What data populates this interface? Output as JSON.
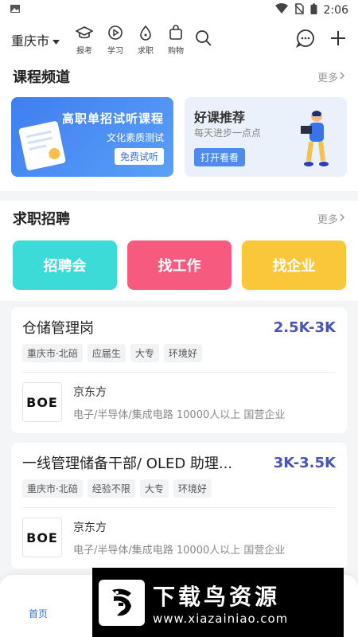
{
  "status": {
    "time": "2:06"
  },
  "topnav": {
    "city": "重庆市",
    "items": [
      {
        "label": "报考",
        "icon": "graduation-cap-icon"
      },
      {
        "label": "学习",
        "icon": "play-circle-icon"
      },
      {
        "label": "求职",
        "icon": "job-icon"
      },
      {
        "label": "购物",
        "icon": "shopping-bag-icon"
      }
    ]
  },
  "courses": {
    "title": "课程频道",
    "more": "更多",
    "card1": {
      "title": "高职单招试听课程",
      "subtitle": "文化素质测试",
      "button": "免费试听"
    },
    "card2": {
      "title": "好课推荐",
      "subtitle": "每天进步一点点",
      "button": "打开看看"
    }
  },
  "jobs": {
    "title": "求职招聘",
    "more": "更多",
    "buttons": [
      "招聘会",
      "找工作",
      "找企业"
    ],
    "colors": {
      "cyan": "#3ddbd8",
      "pink": "#f65a7e",
      "yellow": "#fbc73a",
      "salary": "#4754b8"
    }
  },
  "listings": [
    {
      "title": "仓储管理岗",
      "salary": "2.5K-3K",
      "tags": [
        "重庆市·北碚",
        "应届生",
        "大专",
        "环境好"
      ],
      "company": "京东方",
      "logo": "BOE",
      "meta": "电子/半导体/集成电路  10000人以上  国营企业"
    },
    {
      "title": "一线管理储备干部/ OLED 助理...",
      "salary": "3K-3.5K",
      "tags": [
        "重庆市·北碚",
        "经验不限",
        "大专",
        "环境好"
      ],
      "company": "京东方",
      "logo": "BOE",
      "meta": "电子/半导体/集成电路  10000人以上  国营企业"
    }
  ],
  "bottombar": {
    "home": "首页"
  },
  "watermark": {
    "title": "下载鸟资源",
    "url": "www.xiazainiao.com"
  }
}
